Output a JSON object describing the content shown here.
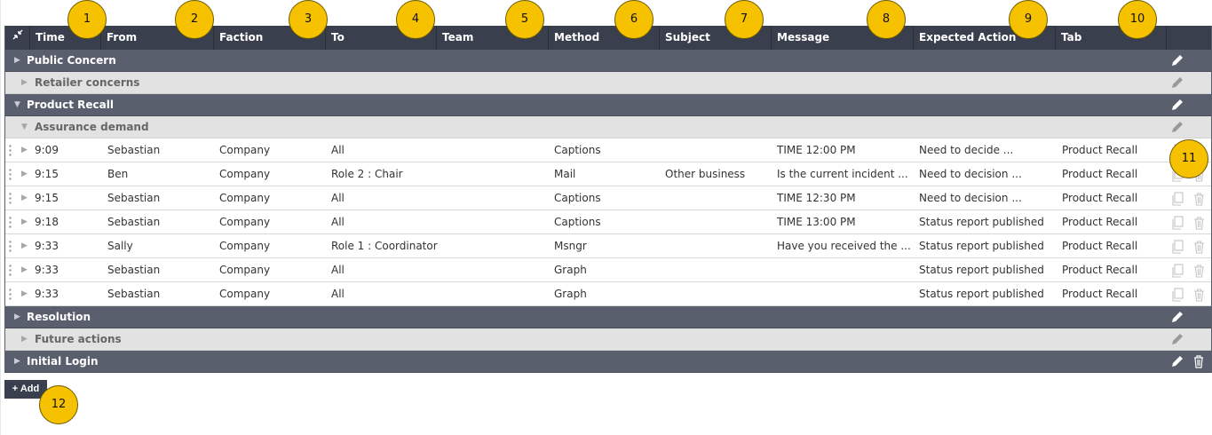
{
  "header": {
    "collapse_icon": "collapse-arrows-icon",
    "columns": [
      "Time",
      "From",
      "Faction",
      "To",
      "Team",
      "Method",
      "Subject",
      "Message",
      "Expected Action",
      "Tab"
    ]
  },
  "groups": {
    "public_concern": "Public Concern",
    "retailer_concerns": "Retailer concerns",
    "product_recall": "Product Recall",
    "assurance_demand": "Assurance demand",
    "resolution": "Resolution",
    "future_actions": "Future actions",
    "initial_login": "Initial Login"
  },
  "rows": [
    {
      "time": "9:09",
      "from": "Sebastian",
      "faction": "Company",
      "to": "All",
      "team": "",
      "method": "Captions",
      "subject": "",
      "message": "TIME 12:00 PM",
      "action": "Need to decide ...",
      "tab": "Product Recall"
    },
    {
      "time": "9:15",
      "from": "Ben",
      "faction": "Company",
      "to": "Role 2 : Chair",
      "team": "",
      "method": "Mail",
      "subject": "Other business",
      "message": "Is the current incident ...",
      "action": "Need to decision ...",
      "tab": "Product Recall"
    },
    {
      "time": "9:15",
      "from": "Sebastian",
      "faction": "Company",
      "to": "All",
      "team": "",
      "method": "Captions",
      "subject": "",
      "message": "TIME 12:30 PM",
      "action": "Need to decision ...",
      "tab": "Product Recall"
    },
    {
      "time": "9:18",
      "from": "Sebastian",
      "faction": "Company",
      "to": "All",
      "team": "",
      "method": "Captions",
      "subject": "",
      "message": "TIME 13:00 PM",
      "action": "Status report published",
      "tab": "Product Recall"
    },
    {
      "time": "9:33",
      "from": "Sally",
      "faction": "Company",
      "to": "Role 1 : Coordinator",
      "team": "",
      "method": "Msngr",
      "subject": "",
      "message": "Have you received the ...",
      "action": "Status report published",
      "tab": "Product Recall"
    },
    {
      "time": "9:33",
      "from": "Sebastian",
      "faction": "Company",
      "to": "All",
      "team": "",
      "method": "Graph",
      "subject": "",
      "message": "",
      "action": "Status report published",
      "tab": "Product Recall"
    },
    {
      "time": "9:33",
      "from": "Sebastian",
      "faction": "Company",
      "to": "All",
      "team": "",
      "method": "Graph",
      "subject": "",
      "message": "",
      "action": "Status report published",
      "tab": "Product Recall"
    }
  ],
  "add_button": "+ Add",
  "callouts": [
    "1",
    "2",
    "3",
    "4",
    "5",
    "6",
    "7",
    "8",
    "9",
    "10",
    "11",
    "12"
  ],
  "colors": {
    "header_bg": "#3a3f4d",
    "group_bg": "#5a5f6e",
    "subgroup_bg": "#e2e2e2",
    "callout": "#f6c200"
  }
}
